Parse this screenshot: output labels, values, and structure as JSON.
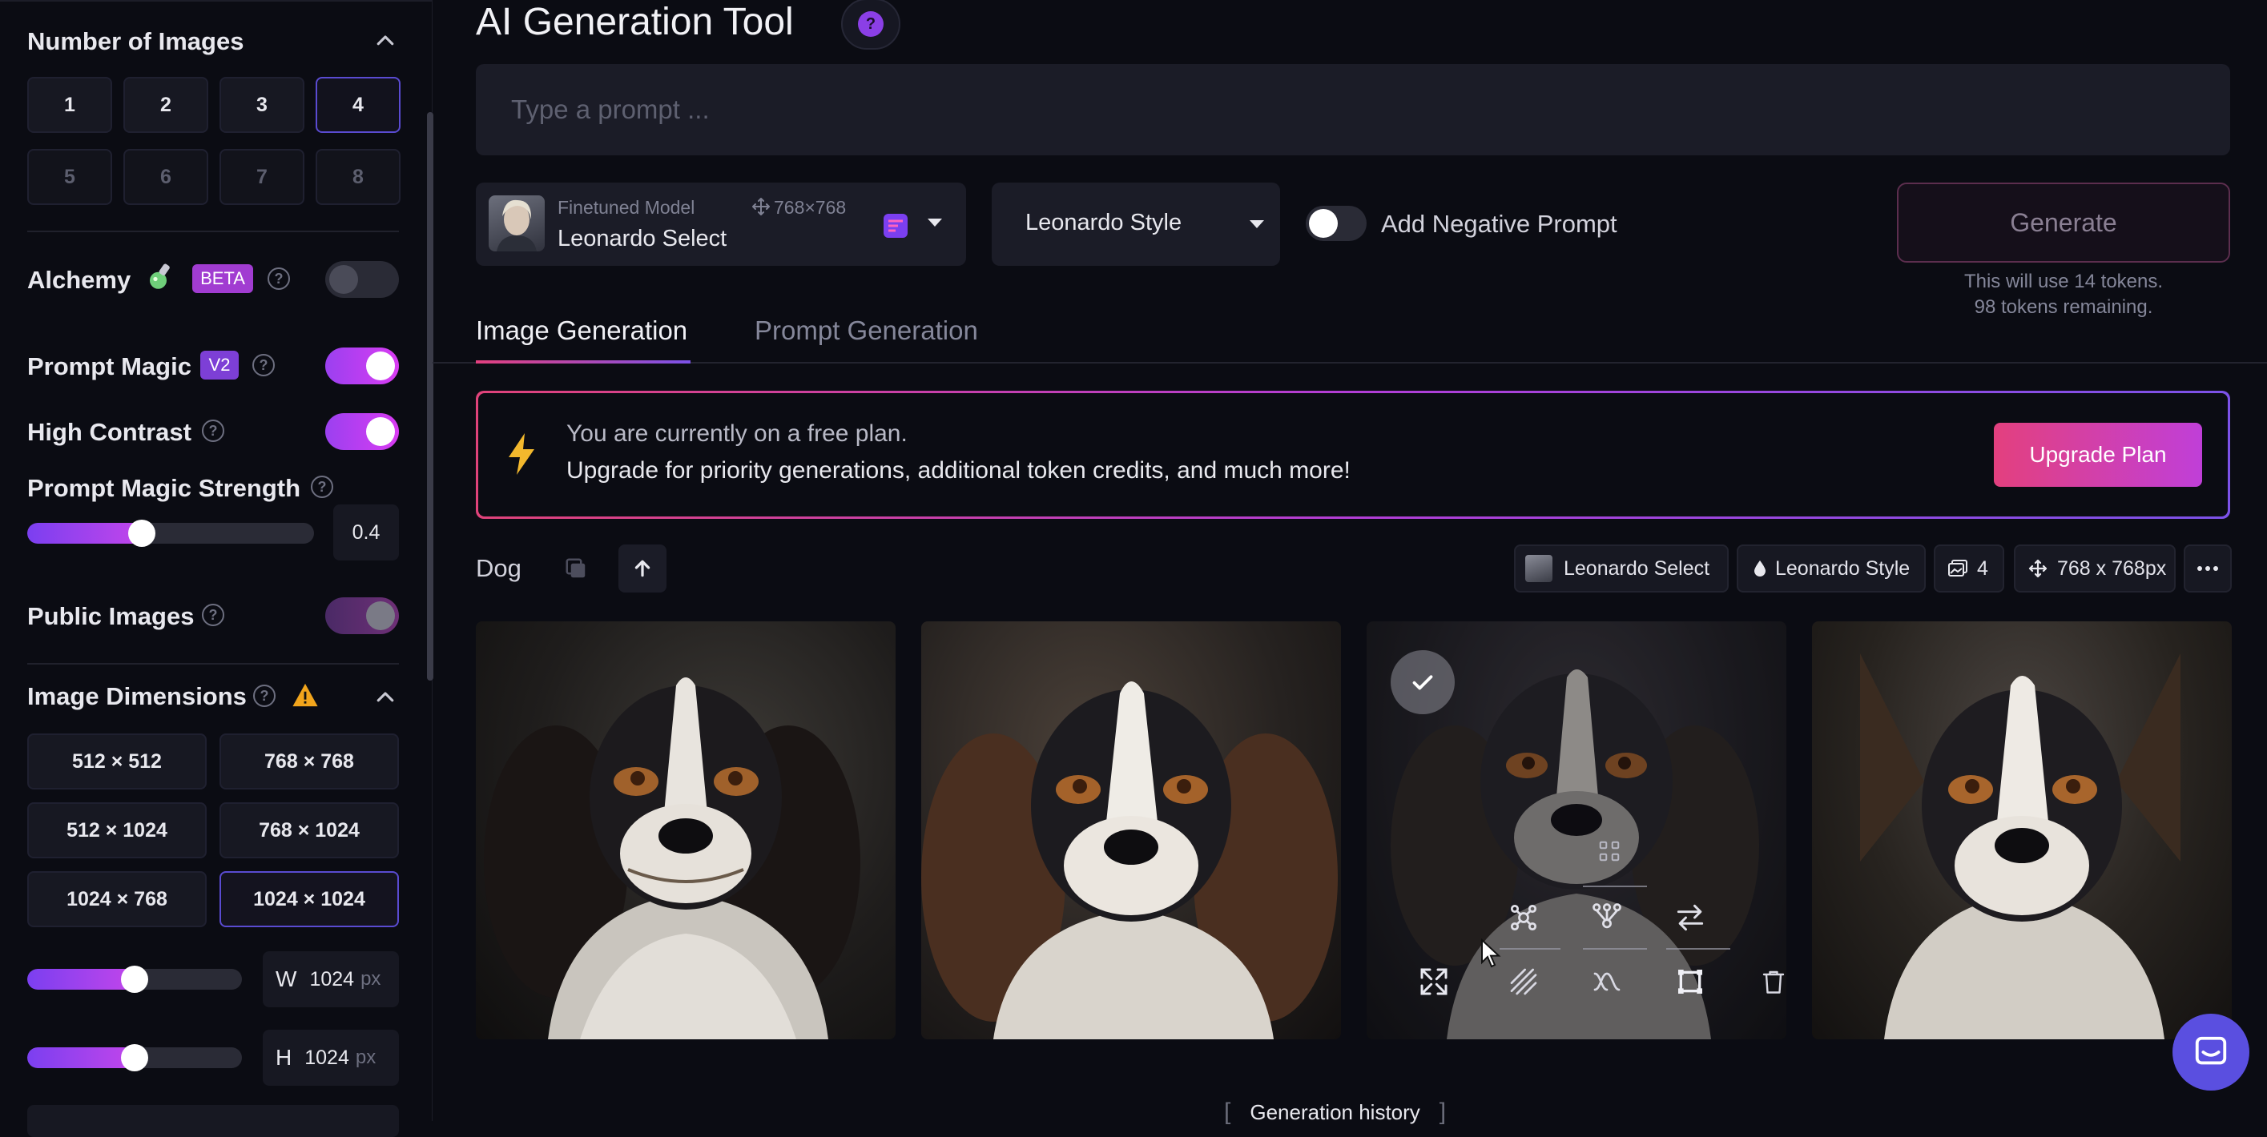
{
  "sidebar": {
    "number_of_images": {
      "title": "Number of Images",
      "options": [
        "1",
        "2",
        "3",
        "4",
        "5",
        "6",
        "7",
        "8"
      ],
      "selected": "4"
    },
    "alchemy": {
      "label": "Alchemy",
      "badge": "BETA",
      "enabled": false
    },
    "prompt_magic": {
      "label": "Prompt Magic",
      "badge": "V2",
      "enabled": true
    },
    "high_contrast": {
      "label": "High Contrast",
      "enabled": true
    },
    "prompt_magic_strength": {
      "label": "Prompt Magic Strength",
      "value": "0.4",
      "fraction": 0.4
    },
    "public_images": {
      "label": "Public Images",
      "enabled": true
    },
    "image_dimensions": {
      "title": "Image Dimensions",
      "options": [
        "512 × 512",
        "768 × 768",
        "512 × 1024",
        "768 × 1024",
        "1024 × 768",
        "1024 × 1024"
      ],
      "selected": "1024 × 1024",
      "width": {
        "label": "W",
        "value": "1024",
        "unit": "px",
        "fraction": 0.5
      },
      "height": {
        "label": "H",
        "value": "1024",
        "unit": "px",
        "fraction": 0.5
      }
    }
  },
  "header": {
    "title": "AI Generation Tool",
    "help_glyph": "?"
  },
  "prompt": {
    "placeholder": "Type a prompt ...",
    "value": ""
  },
  "model_selector": {
    "caption": "Finetuned Model",
    "size": "768×768",
    "name": "Leonardo Select"
  },
  "style_selector": {
    "value": "Leonardo Style"
  },
  "negative_prompt": {
    "label": "Add Negative Prompt",
    "enabled": false
  },
  "generate": {
    "label": "Generate",
    "token_cost": "This will use 14 tokens.",
    "tokens_remaining": "98 tokens remaining."
  },
  "tabs": [
    {
      "label": "Image Generation",
      "active": true
    },
    {
      "label": "Prompt Generation",
      "active": false
    }
  ],
  "banner": {
    "line1": "You are currently on a free plan.",
    "line2": "Upgrade for priority generations, additional token credits, and much more!",
    "button": "Upgrade Plan"
  },
  "generation": {
    "prompt": "Dog",
    "chips": {
      "model": "Leonardo Select",
      "style": "Leonardo Style",
      "count": "4",
      "dimensions": "768 x 768px"
    },
    "images": [
      {
        "name": "dog-image-1",
        "selected": false
      },
      {
        "name": "dog-image-2",
        "selected": false
      },
      {
        "name": "dog-image-3",
        "selected": true
      },
      {
        "name": "dog-image-4",
        "selected": false
      }
    ]
  },
  "footer": {
    "history_label": "Generation history"
  },
  "colors": {
    "accent_purple": "#9b40f0",
    "accent_pink": "#e3407e",
    "background": "#0b0c13",
    "panel": "#1b1c27"
  },
  "icons": [
    "help-icon",
    "chevron-up-icon",
    "potion-icon",
    "warning-icon",
    "move-icon",
    "chevron-down-icon",
    "lightning-icon",
    "copy-icon",
    "arrow-up-icon",
    "ellipsis-icon",
    "check-icon",
    "download-icon",
    "expand-icon",
    "chat-icon"
  ]
}
